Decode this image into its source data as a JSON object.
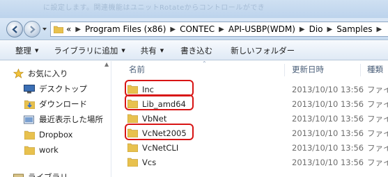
{
  "background_text": "に設定します。関連機能はユニットRotateからコントロールができ",
  "address_bar": {
    "overflow_indicator": "«",
    "crumbs": [
      "Program Files (x86)",
      "CONTEC",
      "API-USBP(WDM)",
      "Dio",
      "Samples"
    ]
  },
  "toolbar": {
    "organize": "整理",
    "include_in_library": "ライブラリに追加",
    "share": "共有",
    "burn": "書き込む",
    "new_folder": "新しいフォルダー"
  },
  "nav_pane": {
    "favorites": "お気に入り",
    "items": [
      {
        "label": "デスクトップ",
        "icon": "desktop-icon"
      },
      {
        "label": "ダウンロード",
        "icon": "downloads-icon"
      },
      {
        "label": "最近表示した場所",
        "icon": "recent-places-icon"
      },
      {
        "label": "Dropbox",
        "icon": "folder-icon"
      },
      {
        "label": "work",
        "icon": "folder-icon"
      }
    ],
    "libraries": "ライブラリ"
  },
  "columns": {
    "name": "名前",
    "date": "更新日時",
    "type": "種類"
  },
  "files": [
    {
      "name": "Inc",
      "date": "2013/10/10 13:56",
      "type": "ファイ",
      "highlighted": true
    },
    {
      "name": "Lib_amd64",
      "date": "2013/10/10 13:56",
      "type": "ファイ",
      "highlighted": true
    },
    {
      "name": "VbNet",
      "date": "2013/10/10 13:56",
      "type": "ファイ",
      "highlighted": false
    },
    {
      "name": "VcNet2005",
      "date": "2013/10/10 13:56",
      "type": "ファイ",
      "highlighted": true
    },
    {
      "name": "VcNetCLI",
      "date": "2013/10/10 13:56",
      "type": "ファイ",
      "highlighted": false
    },
    {
      "name": "Vcs",
      "date": "2013/10/10 13:56",
      "type": "ファイ",
      "highlighted": false
    }
  ],
  "colors": {
    "highlight_border": "#d81414",
    "folder_yellow": "#e8c14e"
  }
}
